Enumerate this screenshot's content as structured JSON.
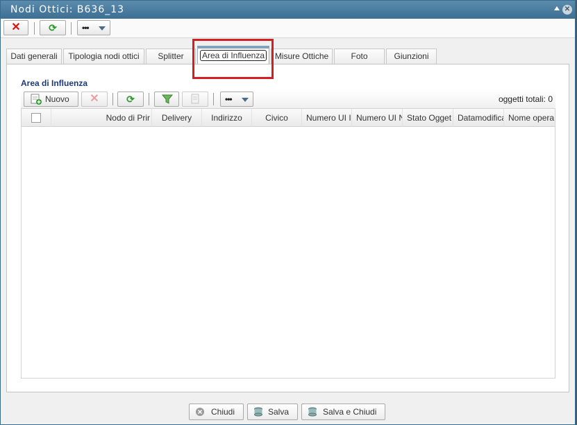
{
  "window": {
    "title": "Nodi Ottici: B636_13"
  },
  "toolbar": {
    "more_label": "•••"
  },
  "tabs": [
    {
      "label": "Dati generali"
    },
    {
      "label": "Tipologia nodi ottici"
    },
    {
      "label": "Splitter"
    },
    {
      "label": "Area di Influenza"
    },
    {
      "label": "Misure Ottiche"
    },
    {
      "label": "Foto"
    },
    {
      "label": "Giunzioni"
    }
  ],
  "panel": {
    "title": "Area di Influenza",
    "new_label": "Nuovo",
    "more_label": "•••",
    "total_label": "oggetti totali: 0"
  },
  "grid": {
    "columns": [
      "Nodo di Prir",
      "Delivery",
      "Indirizzo",
      "Civico",
      "Numero UI I",
      "Numero UI N",
      "Stato Ogget",
      "Datamodifica",
      "Nome opera"
    ],
    "rows": []
  },
  "footer": {
    "close_label": "Chiudi",
    "save_label": "Salva",
    "save_close_label": "Salva e Chiudi"
  },
  "colors": {
    "accent": "#3d6f93",
    "highlight": "#d21f24",
    "panel_title": "#1c3a7a"
  }
}
